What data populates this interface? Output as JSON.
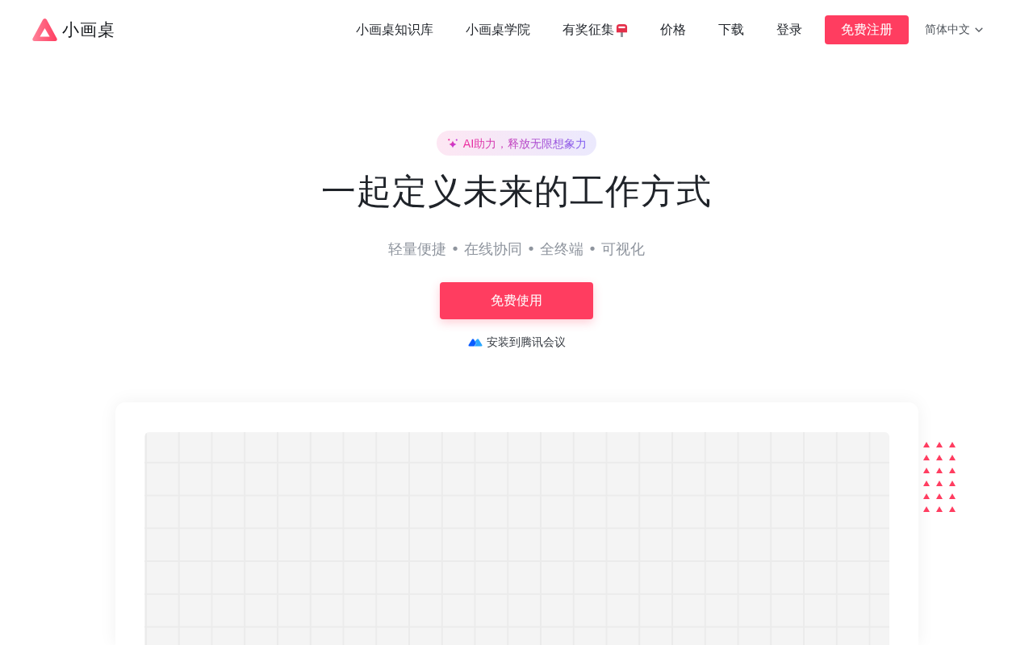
{
  "header": {
    "logo": {
      "text": "小画桌"
    },
    "nav": {
      "links": [
        {
          "label": "小画桌知识库",
          "kind": "text"
        },
        {
          "label": "小画桌学院",
          "kind": "text"
        },
        {
          "label": "有奖征集",
          "kind": "postbox"
        },
        {
          "label": "价格",
          "kind": "text"
        },
        {
          "label": "下载",
          "kind": "text"
        },
        {
          "label": "登录",
          "kind": "text"
        }
      ],
      "signup_button": "免费注册",
      "language": "简体中文"
    }
  },
  "hero": {
    "badge": "AI助力，释放无限想象力",
    "title": "一起定义未来的工作方式",
    "subtitle": "轻量便捷 • 在线协同 • 全终端 • 可视化",
    "cta_button": "免费使用",
    "install_link": "安装到腾讯会议"
  }
}
